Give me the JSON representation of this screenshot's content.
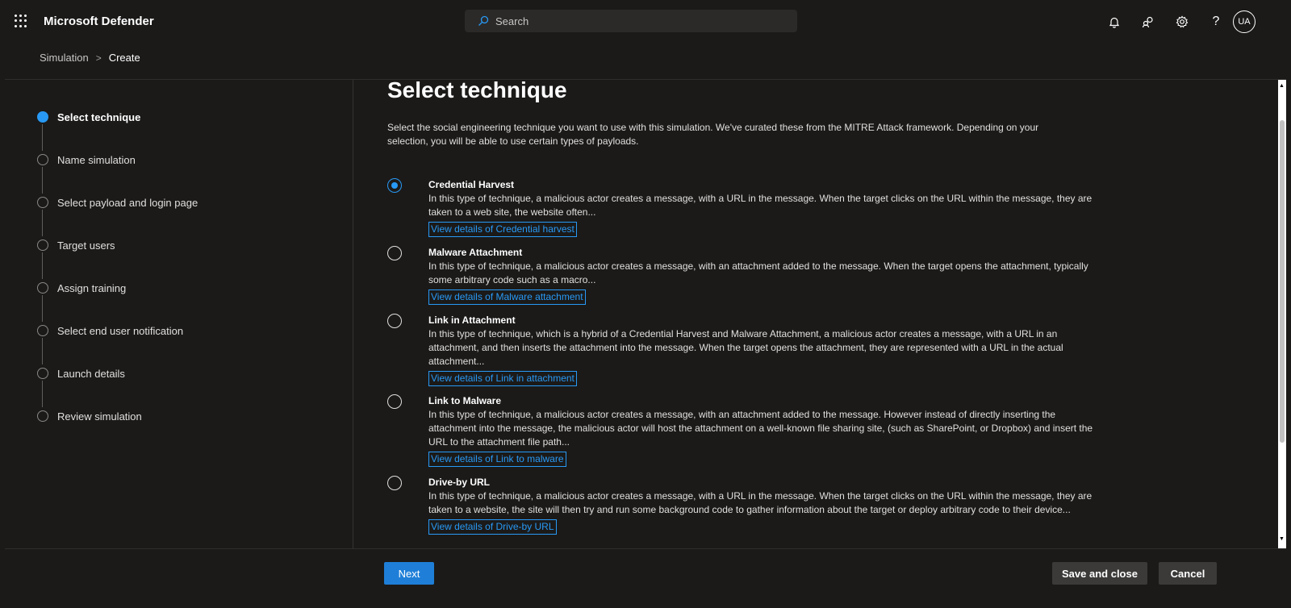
{
  "header": {
    "app_title": "Microsoft Defender",
    "search_placeholder": "Search",
    "avatar_initials": "UA",
    "icons": [
      "waffle-icon",
      "bell-icon",
      "people-icon",
      "gear-icon",
      "help-icon"
    ]
  },
  "breadcrumb": {
    "parent": "Simulation",
    "separator": ">",
    "current": "Create"
  },
  "steps": [
    {
      "label": "Select technique",
      "active": true
    },
    {
      "label": "Name simulation",
      "active": false
    },
    {
      "label": "Select payload and login page",
      "active": false
    },
    {
      "label": "Target users",
      "active": false
    },
    {
      "label": "Assign training",
      "active": false
    },
    {
      "label": "Select end user notification",
      "active": false
    },
    {
      "label": "Launch details",
      "active": false
    },
    {
      "label": "Review simulation",
      "active": false
    }
  ],
  "main": {
    "title": "Select technique",
    "intro": "Select the social engineering technique you want to use with this simulation. We've curated these from the MITRE Attack framework. Depending on your selection, you will be able to use certain types of payloads.",
    "options": [
      {
        "title": "Credential Harvest",
        "description": "In this type of technique, a malicious actor creates a message, with a URL in the message. When the target clicks on the URL within the message, they are taken to a web site, the website often...",
        "link": "View details of Credential harvest",
        "selected": true
      },
      {
        "title": "Malware Attachment",
        "description": "In this type of technique, a malicious actor creates a message, with an attachment added to the message. When the target opens the attachment, typically some arbitrary code such as a macro...",
        "link": "View details of Malware attachment",
        "selected": false
      },
      {
        "title": "Link in Attachment",
        "description": "In this type of technique, which is a hybrid of a Credential Harvest and Malware Attachment, a malicious actor creates a message, with a URL in an attachment, and then inserts the attachment into the message. When the target opens the attachment, they are represented with a URL in the actual attachment...",
        "link": "View details of Link in attachment",
        "selected": false
      },
      {
        "title": "Link to Malware",
        "description": "In this type of technique, a malicious actor creates a message, with an attachment added to the message. However instead of directly inserting the attachment into the message, the malicious actor will host the attachment on a well-known file sharing site, (such as SharePoint, or Dropbox) and insert the URL to the attachment file path...",
        "link": "View details of Link to malware",
        "selected": false
      },
      {
        "title": "Drive-by URL",
        "description": "In this type of technique, a malicious actor creates a message, with a URL in the message. When the target clicks on the URL within the message, they are taken to a website, the site will then try and run some background code to gather information about the target or deploy arbitrary code to their device...",
        "link": "View details of Drive-by URL",
        "selected": false
      }
    ]
  },
  "footer": {
    "next_label": "Next",
    "save_label": "Save and close",
    "cancel_label": "Cancel"
  },
  "colors": {
    "accent": "#2899f5",
    "primary_button": "#1f7fd8",
    "background": "#1b1a19"
  }
}
